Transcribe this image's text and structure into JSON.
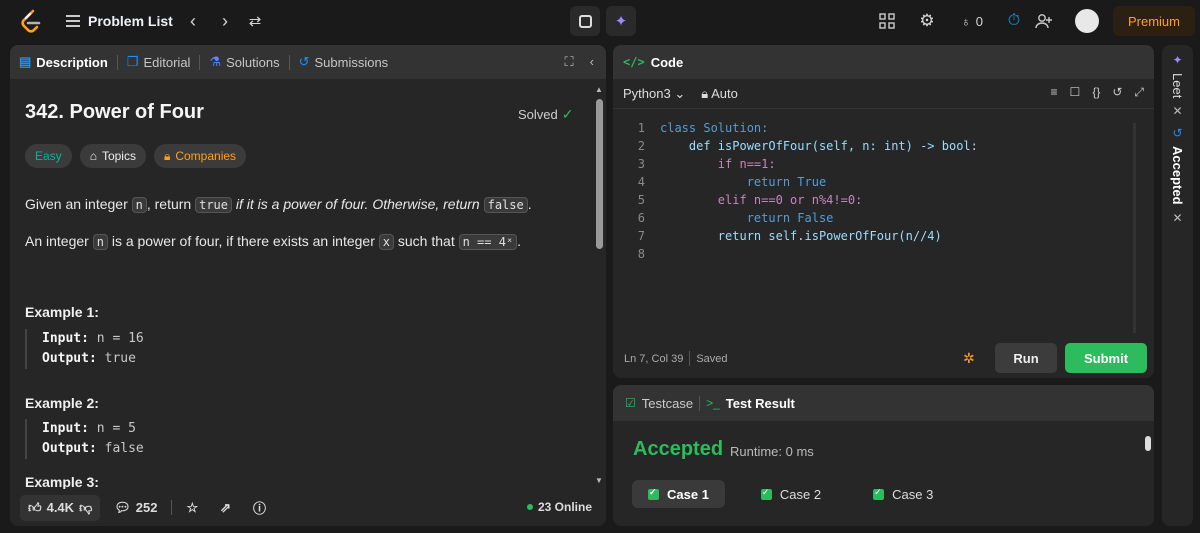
{
  "topbar": {
    "problem_list": "Problem List",
    "prev": "‹",
    "next": "›",
    "streak_count": "0",
    "premium": "Premium"
  },
  "left": {
    "tabs": [
      "Description",
      "Editorial",
      "Solutions",
      "Submissions"
    ],
    "problem_title": "342. Power of Four",
    "solved_label": "Solved",
    "difficulty": "Easy",
    "topics": "Topics",
    "companies": "Companies",
    "desc": {
      "p1_pre": "Given an integer ",
      "p1_n": "n",
      "p1_mid": ", return ",
      "p1_true": "true",
      "p1_italic": " if it is a power of four. Otherwise, return ",
      "p1_false": "false",
      "p1_end": ".",
      "p2_pre": "An integer ",
      "p2_n": "n",
      "p2_mid": " is a power of four, if there exists an integer ",
      "p2_x": "x",
      "p2_post": " such that ",
      "p2_formula": "n == 4ˣ",
      "p2_end": "."
    },
    "examples": [
      {
        "title": "Example 1:",
        "input_label": "Input:",
        "input": " n = 16",
        "output_label": "Output:",
        "output": " true"
      },
      {
        "title": "Example 2:",
        "input_label": "Input:",
        "input": " n = 5",
        "output_label": "Output:",
        "output": " false"
      },
      {
        "title": "Example 3:"
      }
    ],
    "footer": {
      "likes": "4.4K",
      "comments": "252",
      "online": "23 Online"
    }
  },
  "code": {
    "header": "Code",
    "language": "Python3",
    "auto": "Auto",
    "lines": [
      "class Solution:",
      "    def isPowerOfFour(self, n: int) -> bool:",
      "        if n==1:",
      "            return True",
      "        elif n==0 or n%4!=0:",
      "            return False",
      "        return self.isPowerOfFour(n//4)",
      ""
    ],
    "line_numbers": [
      "1",
      "2",
      "3",
      "4",
      "5",
      "6",
      "7",
      "8"
    ],
    "cursor": "Ln 7, Col 39",
    "saved": "Saved",
    "run": "Run",
    "submit": "Submit"
  },
  "test": {
    "testcase_tab": "Testcase",
    "result_tab": "Test Result",
    "status": "Accepted",
    "runtime": "Runtime: 0 ms",
    "cases": [
      "Case 1",
      "Case 2",
      "Case 3"
    ]
  },
  "side": {
    "leet": "Leet",
    "accepted": "Accepted"
  },
  "colors": {
    "accent_green": "#2cbb5d",
    "premium_orange": "#ffa116",
    "link_blue": "#1a90ff"
  }
}
